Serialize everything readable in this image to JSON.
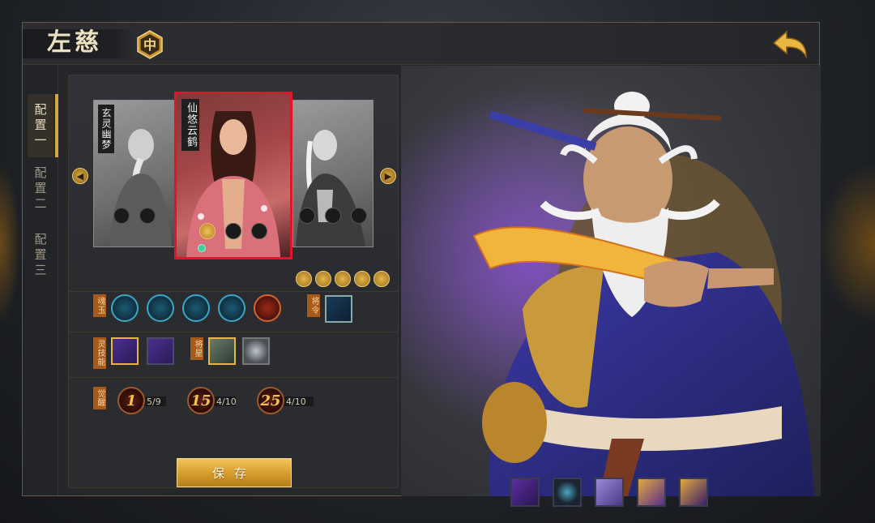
{
  "header": {
    "title": "左慈",
    "rank_badge": "中"
  },
  "config_tabs": [
    {
      "label": "配置一",
      "active": true
    },
    {
      "label": "配置二",
      "active": false
    },
    {
      "label": "配置三",
      "active": false
    }
  ],
  "skins": {
    "left": {
      "label": "玄灵幽梦"
    },
    "center": {
      "label": "仙悠云鹤"
    }
  },
  "rows": {
    "soul_label": "魂玉",
    "general_order_label": "将令",
    "spirit_skill_label": "灵技能",
    "general_star_label": "将星",
    "awaken_label": "觉醒"
  },
  "awaken": [
    {
      "level": "1",
      "count": "5/9"
    },
    {
      "level": "15",
      "count": "4/10"
    },
    {
      "level": "25",
      "count": "4/10"
    }
  ],
  "save_label": "保存",
  "icons": {
    "back": "back-arrow-icon",
    "carousel_prev": "chevron-left-icon",
    "carousel_next": "chevron-right-icon"
  },
  "colors": {
    "accent_gold": "#d6a640",
    "selected_border": "#e0142a",
    "panel": "#2b2c30"
  }
}
